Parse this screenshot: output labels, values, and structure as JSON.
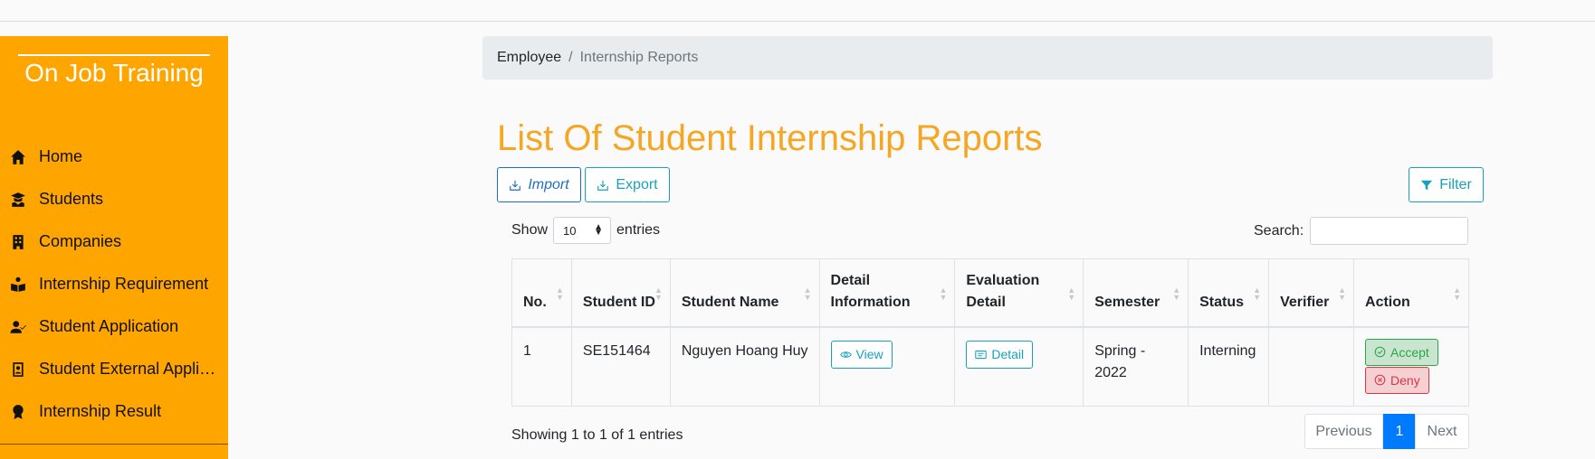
{
  "sidebar": {
    "brand": "On Job Training",
    "items": [
      {
        "label": "Home",
        "icon": "home-icon"
      },
      {
        "label": "Students",
        "icon": "graduate-icon"
      },
      {
        "label": "Companies",
        "icon": "building-icon"
      },
      {
        "label": "Internship Requirement",
        "icon": "book-reader-icon"
      },
      {
        "label": "Student Application",
        "icon": "user-check-icon"
      },
      {
        "label": "Student External Appli…",
        "icon": "id-badge-icon"
      },
      {
        "label": "Internship Result",
        "icon": "award-icon"
      }
    ],
    "color": "#ffa500"
  },
  "breadcrumb": {
    "home": "Employee",
    "separator": "/",
    "active": "Internship Reports"
  },
  "page": {
    "title": "List Of Student Internship Reports",
    "title_color": "#f5a623"
  },
  "toolbar": {
    "import_label": "Import",
    "export_label": "Export",
    "filter_label": "Filter"
  },
  "table_controls": {
    "show_label": "Show",
    "entries_value": "10",
    "entries_label": "entries",
    "search_label": "Search:",
    "search_value": ""
  },
  "table": {
    "headers": [
      "No.",
      "Student ID",
      "Student Name",
      "Detail Information",
      "Evaluation Detail",
      "Semester",
      "Status",
      "Verifier",
      "Action"
    ],
    "rows": [
      {
        "no": "1",
        "student_id": "SE151464",
        "student_name": "Nguyen Hoang Huy",
        "view_label": "View",
        "detail_label": "Detail",
        "semester": "Spring - 2022",
        "status": "Interning",
        "verifier": "",
        "accept_label": "Accept",
        "deny_label": "Deny"
      }
    ]
  },
  "footer": {
    "showing": "Showing 1 to 1 of 1 entries",
    "previous": "Previous",
    "current_page": "1",
    "next": "Next"
  }
}
